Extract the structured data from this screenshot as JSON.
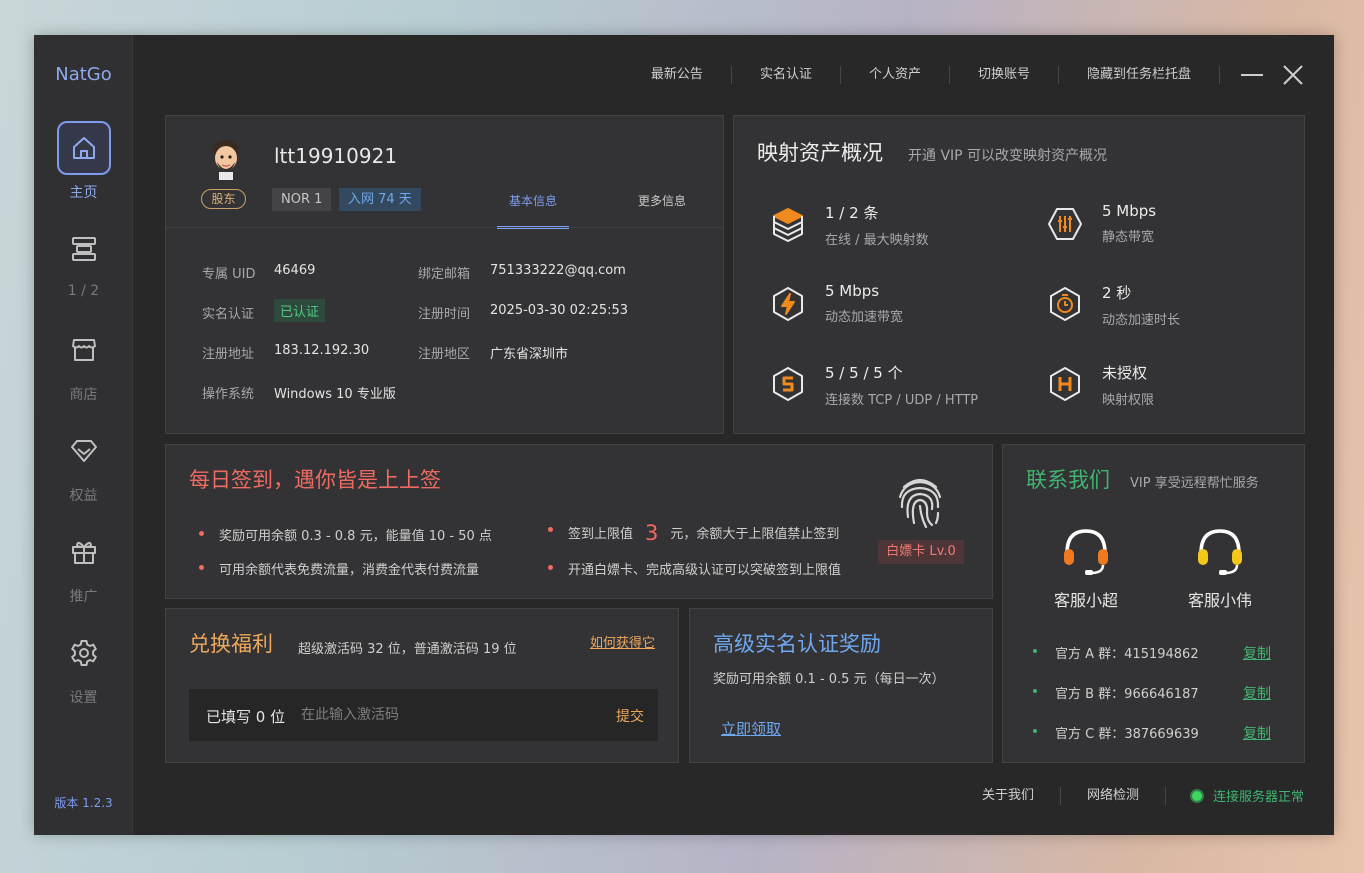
{
  "app": {
    "logo": "NatGo",
    "version": "版本 1.2.3"
  },
  "sidebar": {
    "items": [
      {
        "label": "主页",
        "icon": "home-icon",
        "active": true
      },
      {
        "label": "1 / 2",
        "icon": "mapping-icon",
        "active": false
      },
      {
        "label": "商店",
        "icon": "store-icon",
        "active": false
      },
      {
        "label": "权益",
        "icon": "diamond-icon",
        "active": false
      },
      {
        "label": "推广",
        "icon": "gift-icon",
        "active": false
      },
      {
        "label": "设置",
        "icon": "gear-icon",
        "active": false
      }
    ]
  },
  "topnav": [
    "最新公告",
    "实名认证",
    "个人资产",
    "切换账号",
    "隐藏到任务栏托盘"
  ],
  "profile": {
    "username": "ltt19910921",
    "role_tag": "股东",
    "level": "NOR 1",
    "days": "入网 74 天",
    "tab_basic": "基本信息",
    "tab_more": "更多信息",
    "uid_label": "专属 UID",
    "uid": "46469",
    "email_label": "绑定邮箱",
    "email": "751333222@qq.com",
    "verify_label": "实名认证",
    "verify_status": "已认证",
    "regtime_label": "注册时间",
    "regtime": "2025-03-30 02:25:53",
    "ip_label": "注册地址",
    "ip": "183.12.192.30",
    "region_label": "注册地区",
    "region": "广东省深圳市",
    "os_label": "操作系统",
    "os": "Windows 10 专业版"
  },
  "assets": {
    "title": "映射资产概况",
    "subtitle": "开通 VIP 可以改变映射资产概况",
    "stats": [
      {
        "value": "1 / 2 条",
        "label": "在线 / 最大映射数",
        "icon": "cube-stack-icon"
      },
      {
        "value": "5 Mbps",
        "label": "静态带宽",
        "icon": "equalizer-icon"
      },
      {
        "value": "5 Mbps",
        "label": "动态加速带宽",
        "icon": "lightning-icon"
      },
      {
        "value": "2 秒",
        "label": "动态加速时长",
        "icon": "timer-icon"
      },
      {
        "value": "5 / 5 / 5 个",
        "label": "连接数 TCP / UDP / HTTP",
        "icon": "connection-icon"
      },
      {
        "value": "未授权",
        "label": "映射权限",
        "icon": "permission-h-icon"
      }
    ]
  },
  "checkin": {
    "title": "每日签到，遇你皆是上上签",
    "line1": "奖励可用余额 0.3 - 0.8 元，能量值 10 - 50 点",
    "line2": "可用余额代表免费流量，消费金代表付费流量",
    "line3_pre": "签到上限值",
    "line3_num": "3",
    "line3_post": "元，余额大于上限值禁止签到",
    "line4": "开通白嫖卡、完成高级认证可以突破签到上限值",
    "card": "白嫖卡 Lv.0"
  },
  "contact": {
    "title": "联系我们",
    "subtitle": "VIP 享受远程帮忙服务",
    "agents": [
      {
        "name": "客服小超",
        "color": "#f07a1e"
      },
      {
        "name": "客服小伟",
        "color": "#f2c81a"
      }
    ],
    "groups": [
      {
        "text": "官方 A 群：415194862",
        "copy": "复制"
      },
      {
        "text": "官方 B 群：966646187",
        "copy": "复制"
      },
      {
        "text": "官方 C 群：387669639",
        "copy": "复制"
      }
    ]
  },
  "redeem": {
    "title": "兑换福利",
    "subtitle": "超级激活码 32 位，普通激活码 19 位",
    "how": "如何获得它",
    "filled": "已填写 0 位",
    "placeholder": "在此输入激活码",
    "submit": "提交"
  },
  "verify": {
    "title": "高级实名认证奖励",
    "subtitle": "奖励可用余额 0.1 - 0.5 元（每日一次）",
    "claim": "立即领取"
  },
  "footer": {
    "about": "关于我们",
    "network": "网络检测",
    "status": "连接服务器正常"
  },
  "colors": {
    "accent_blue": "#7e9cf0",
    "red": "#ef6b62",
    "green": "#3fb56f",
    "orange": "#eea85b"
  }
}
